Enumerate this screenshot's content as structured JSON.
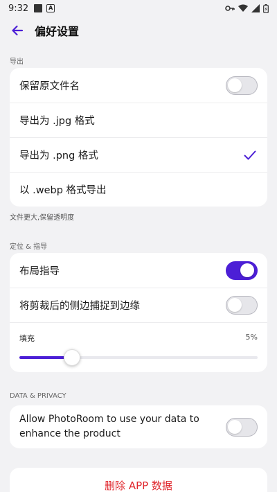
{
  "status_bar": {
    "time": "9:32",
    "icons": [
      "photo-notification-icon",
      "a-notification-icon",
      "key-icon",
      "wifi-icon",
      "signal-icon",
      "battery-icon"
    ]
  },
  "app_bar": {
    "title": "偏好设置",
    "back_icon": "arrow-left-icon"
  },
  "export": {
    "section_label": "导出",
    "items": [
      {
        "label": "保留原文件名",
        "control": "toggle",
        "on": false
      },
      {
        "label": "导出为 .jpg 格式",
        "control": "none"
      },
      {
        "label": "导出为 .png 格式",
        "control": "check",
        "selected": true
      },
      {
        "label": "以 .webp 格式导出",
        "control": "none"
      }
    ],
    "footnote": "文件更大,保留透明度"
  },
  "positioning": {
    "section_label": "定位 & 指导",
    "items": [
      {
        "label": "布局指导",
        "control": "toggle",
        "on": true
      },
      {
        "label": "将剪裁后的侧边捕捉到边缘",
        "control": "toggle",
        "on": false
      }
    ],
    "padding": {
      "label": "填充",
      "value_text": "5%",
      "slider_fraction": 0.22
    }
  },
  "privacy": {
    "section_label": "DATA & PRIVACY",
    "item": {
      "label": "Allow PhotoRoom to use your data to enhance the product",
      "on": false
    }
  },
  "danger": {
    "delete_label": "删除 APP 数据"
  },
  "colors": {
    "accent": "#4c1fd6",
    "danger": "#e0262c",
    "background": "#f2f2f4"
  }
}
